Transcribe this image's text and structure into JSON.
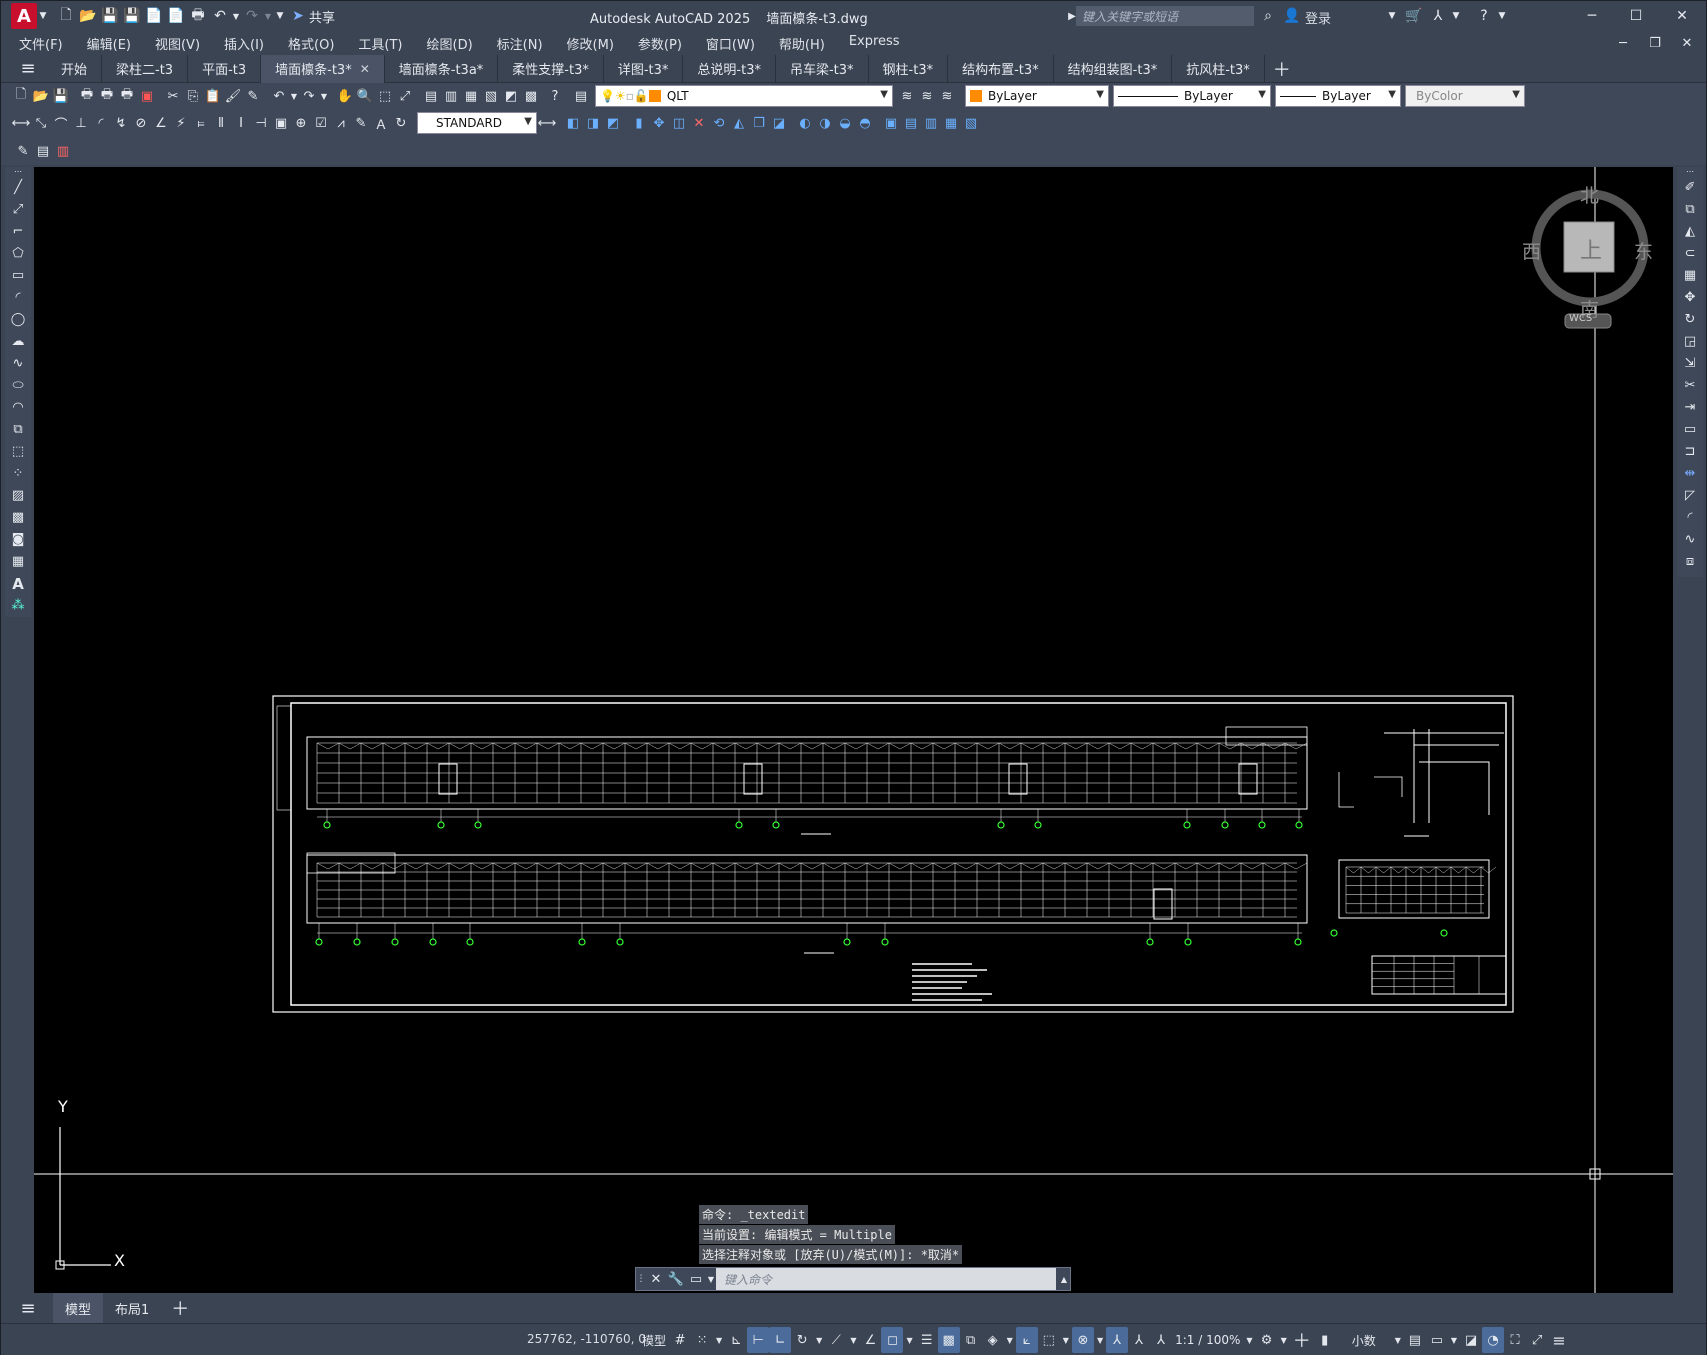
{
  "titlebar": {
    "app_title": "Autodesk AutoCAD 2025",
    "file_title": "墙面檩条-t3.dwg",
    "search_placeholder": "键入关键字或短语",
    "share_label": "共享",
    "login_label": "登录"
  },
  "menubar": {
    "items": [
      "文件(F)",
      "编辑(E)",
      "视图(V)",
      "插入(I)",
      "格式(O)",
      "工具(T)",
      "绘图(D)",
      "标注(N)",
      "修改(M)",
      "参数(P)",
      "窗口(W)",
      "帮助(H)",
      "Express"
    ]
  },
  "tabs": {
    "items": [
      "开始",
      "梁柱二-t3",
      "平面-t3",
      "墙面檩条-t3*",
      "墙面檩条-t3a*",
      "柔性支撑-t3*",
      "详图-t3*",
      "总说明-t3*",
      "吊车梁-t3*",
      "钢柱-t3*",
      "结构布置-t3*",
      "结构组装图-t3*",
      "抗风柱-t3*"
    ],
    "active_index": 3
  },
  "toolbar": {
    "layer_value": "QLT",
    "color_value": "ByLayer",
    "linetype_value": "ByLayer",
    "lineweight_value": "ByLayer",
    "plotstyle_value": "ByColor",
    "dimstyle_value": "STANDARD",
    "layer_color": "#ff8c00",
    "color_swatch": "#ff8c00"
  },
  "viewcube": {
    "north": "北",
    "south": "南",
    "east": "东",
    "west": "西",
    "face": "上",
    "wcs": "WCS"
  },
  "ucs": {
    "x_label": "X",
    "y_label": "Y"
  },
  "command": {
    "history": [
      "命令: _textedit",
      "当前设置: 编辑模式 = Multiple",
      "选择注释对象或 [放弃(U)/模式(M)]: *取消*"
    ],
    "input_placeholder": "键入命令"
  },
  "layout_tabs": {
    "items": [
      "模型",
      "布局1"
    ],
    "active_index": 0
  },
  "statusbar": {
    "coordinates": "257762, -110760, 0",
    "model_label": "模型",
    "scale_label": "1:1 / 100%",
    "units_label": "小数"
  }
}
